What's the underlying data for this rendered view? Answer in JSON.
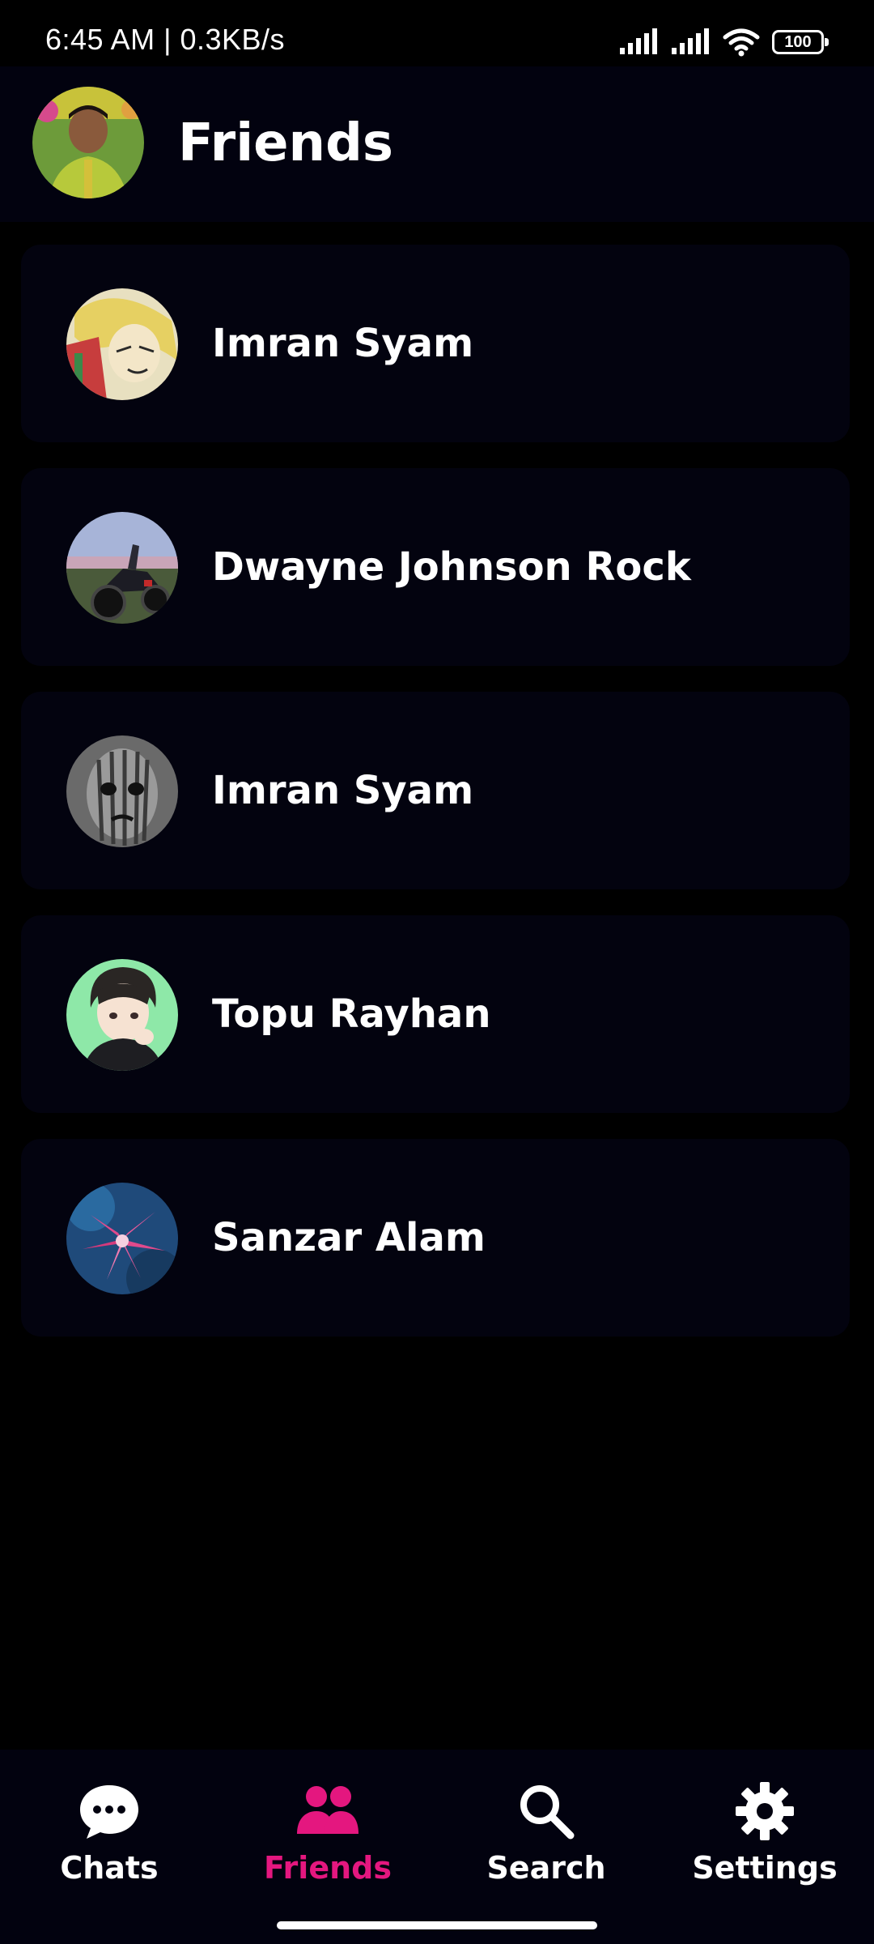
{
  "status_bar": {
    "time_speed": "6:45 AM | 0.3KB/s",
    "battery": "100",
    "icons": [
      "signal-icon",
      "signal-icon",
      "wifi-icon",
      "battery-icon"
    ]
  },
  "app_bar": {
    "title": "Friends",
    "avatar_icon": "profile-avatar"
  },
  "friends": [
    {
      "name": "Imran Syam",
      "avatar": "anime-blonde-avatar"
    },
    {
      "name": "Dwayne Johnson Rock",
      "avatar": "motorbike-avatar"
    },
    {
      "name": "Imran Syam",
      "avatar": "grey-face-avatar"
    },
    {
      "name": "Topu Rayhan",
      "avatar": "anime-boy-avatar"
    },
    {
      "name": "Sanzar Alam",
      "avatar": "flower-avatar"
    }
  ],
  "bottom_nav": {
    "items": [
      {
        "label": "Chats",
        "icon": "chat-bubble-icon",
        "active": false
      },
      {
        "label": "Friends",
        "icon": "people-icon",
        "active": true
      },
      {
        "label": "Search",
        "icon": "search-icon",
        "active": false
      },
      {
        "label": "Settings",
        "icon": "gear-icon",
        "active": false
      }
    ]
  },
  "colors": {
    "accent": "#e4177f",
    "card": "#03030f",
    "bar": "#02020f",
    "background": "#000000"
  }
}
